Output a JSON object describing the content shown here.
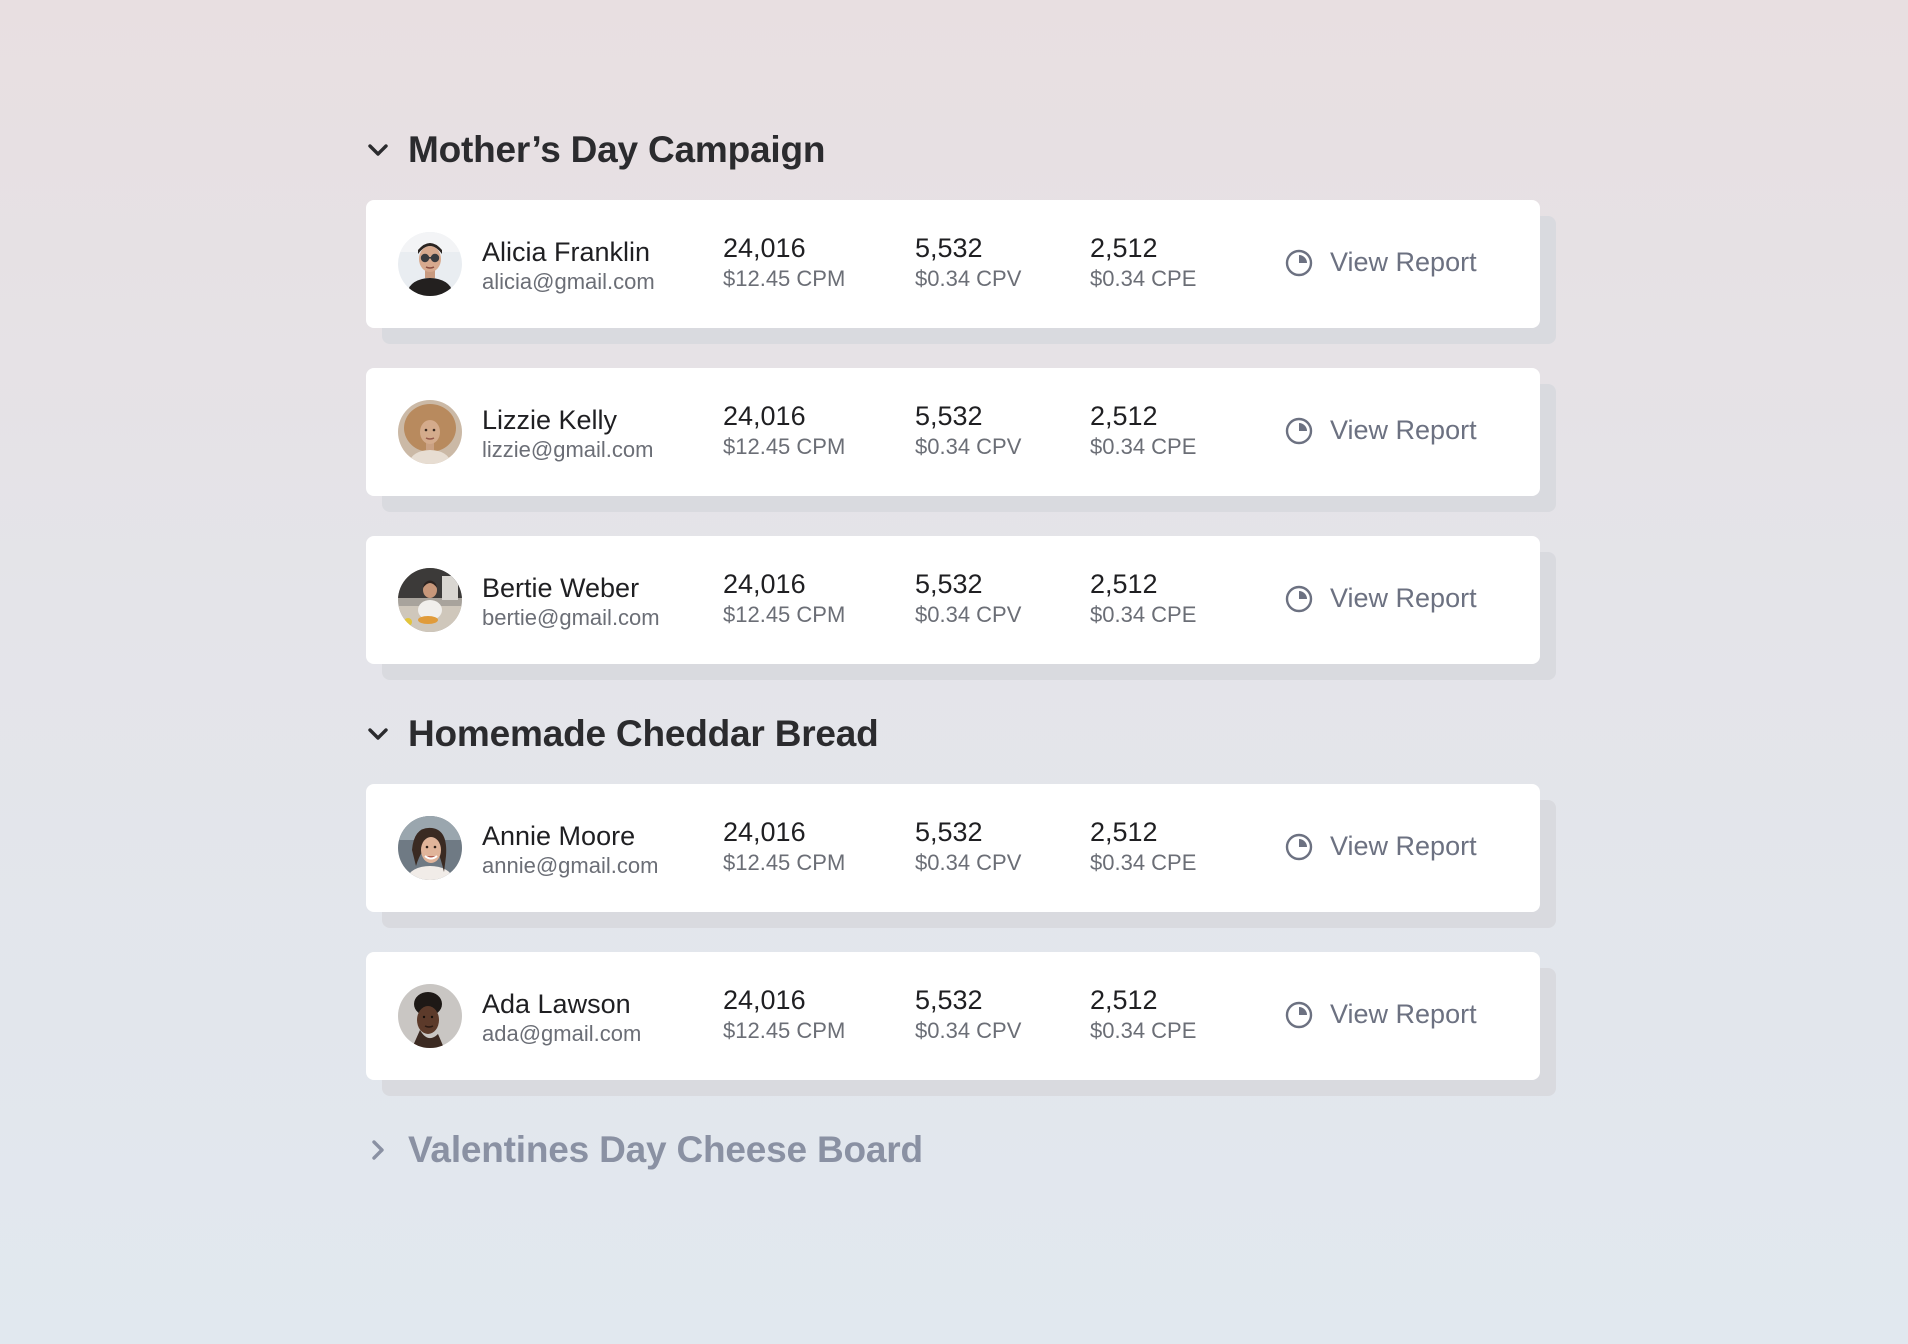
{
  "groups": [
    {
      "title": "Mother’s Day Campaign",
      "expanded": true,
      "rows": [
        {
          "name": "Alicia Franklin",
          "email": "alicia@gmail.com",
          "impressions": "24,016",
          "cpm": "$12.45 CPM",
          "views": "5,532",
          "cpv": "$0.34 CPV",
          "engagements": "2,512",
          "cpe": "$0.34 CPE",
          "action": "View Report"
        },
        {
          "name": "Lizzie Kelly",
          "email": "lizzie@gmail.com",
          "impressions": "24,016",
          "cpm": "$12.45 CPM",
          "views": "5,532",
          "cpv": "$0.34 CPV",
          "engagements": "2,512",
          "cpe": "$0.34 CPE",
          "action": "View Report"
        },
        {
          "name": "Bertie Weber",
          "email": "bertie@gmail.com",
          "impressions": "24,016",
          "cpm": "$12.45 CPM",
          "views": "5,532",
          "cpv": "$0.34 CPV",
          "engagements": "2,512",
          "cpe": "$0.34 CPE",
          "action": "View Report"
        }
      ]
    },
    {
      "title": "Homemade Cheddar Bread",
      "expanded": true,
      "rows": [
        {
          "name": "Annie Moore",
          "email": "annie@gmail.com",
          "impressions": "24,016",
          "cpm": "$12.45 CPM",
          "views": "5,532",
          "cpv": "$0.34 CPV",
          "engagements": "2,512",
          "cpe": "$0.34 CPE",
          "action": "View Report"
        },
        {
          "name": "Ada Lawson",
          "email": "ada@gmail.com",
          "impressions": "24,016",
          "cpm": "$12.45 CPM",
          "views": "5,532",
          "cpv": "$0.34 CPV",
          "engagements": "2,512",
          "cpe": "$0.34 CPE",
          "action": "View Report"
        }
      ]
    },
    {
      "title": "Valentines Day Cheese Board",
      "expanded": false,
      "rows": []
    }
  ],
  "icons": {
    "expanded": "chevron-down-icon",
    "collapsed": "chevron-right-icon",
    "report": "pie-chart-icon"
  },
  "colors": {
    "title": "#2b2b2e",
    "title_collapsed": "#8a91a3",
    "report": "#6c7181",
    "card": "#ffffff"
  }
}
